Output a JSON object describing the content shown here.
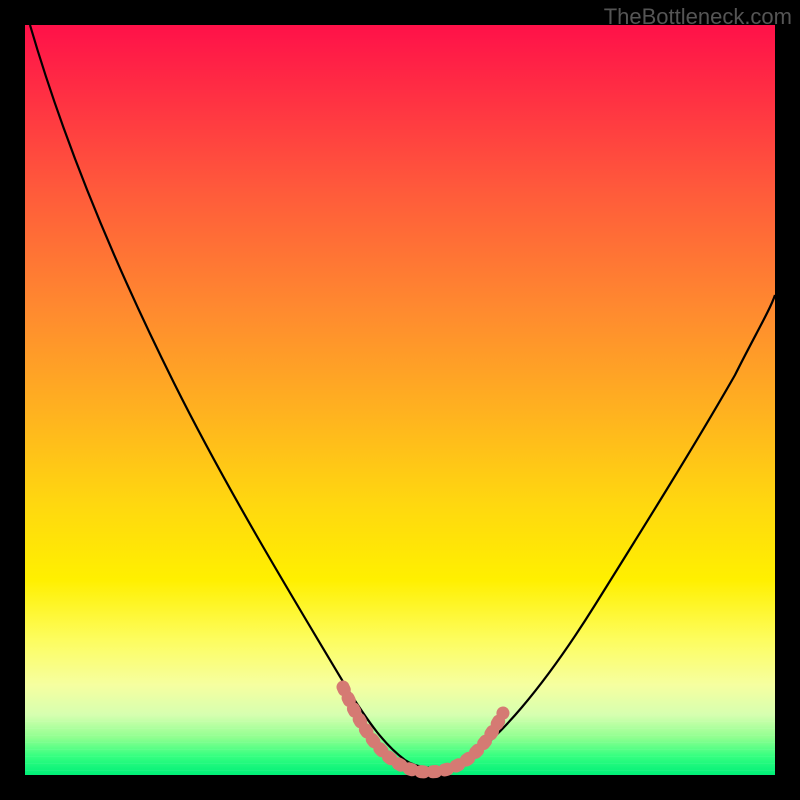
{
  "watermark": "TheBottleneck.com",
  "chart_data": {
    "type": "line",
    "title": "",
    "xlabel": "",
    "ylabel": "",
    "xlim": [
      0,
      100
    ],
    "ylim": [
      0,
      100
    ],
    "background_gradient": {
      "top_color": "#ff1149",
      "bottom_color": "#00ef78",
      "meaning": "red = high bottleneck, green = optimal"
    },
    "series": [
      {
        "name": "bottleneck-curve",
        "color": "#000000",
        "x": [
          0,
          5,
          10,
          15,
          20,
          25,
          30,
          35,
          40,
          44,
          48,
          52,
          56,
          60,
          64,
          68,
          72,
          76,
          80,
          84,
          88,
          92,
          96,
          100
        ],
        "values": [
          100,
          90,
          80,
          70,
          60,
          50,
          40,
          30,
          20,
          10,
          2,
          0,
          0,
          2,
          8,
          15,
          23,
          31,
          39,
          46,
          52,
          57,
          61,
          64
        ]
      },
      {
        "name": "optimal-zone-highlight",
        "color": "#d57a73",
        "x": [
          44,
          46,
          48,
          50,
          52,
          54,
          56,
          58,
          60
        ],
        "values": [
          6,
          3,
          1,
          0,
          0,
          0,
          1,
          2,
          4
        ]
      }
    ],
    "annotations": []
  }
}
